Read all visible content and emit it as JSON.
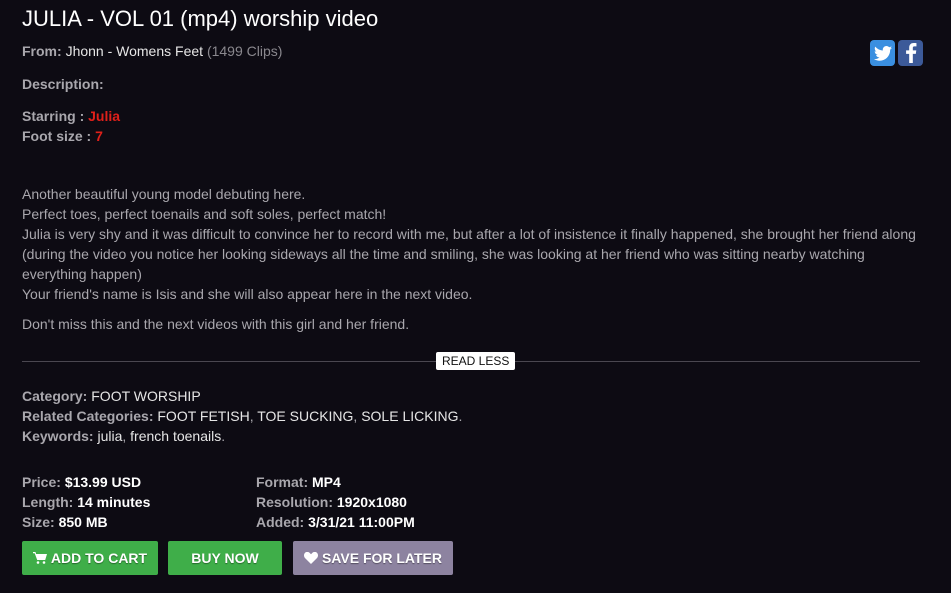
{
  "title": "JULIA - VOL 01 (mp4) worship video",
  "from": {
    "label": "From:",
    "studio": "Jhonn - Womens Feet",
    "clips": "(1499 Clips)"
  },
  "social": {
    "twitter_icon": "twitter-icon",
    "facebook_icon": "facebook-icon",
    "twitter_color": "#3a8fe0",
    "facebook_color": "#3c5a99"
  },
  "description_label": "Description:",
  "starring": {
    "label": "Starring :",
    "value": "Julia"
  },
  "foot_size": {
    "label": "Foot size :",
    "value": "7"
  },
  "body": [
    "Another beautiful young model debuting here.",
    "Perfect toes, perfect toenails and soft soles, perfect match!",
    "Julia is very shy and it was difficult to convince her to record with me, but after a lot of insistence it finally happened, she brought her friend along (during the video you notice her looking sideways all the time and smiling, she was looking at her friend who was sitting nearby watching everything happen)",
    "Your friend's name is Isis and she will also appear here in the next video.",
    "Don't miss this and the next videos with this girl and her friend."
  ],
  "read_less": "READ LESS",
  "category": {
    "label": "Category:",
    "value": "FOOT WORSHIP"
  },
  "related": {
    "label": "Related Categories:",
    "items": [
      "FOOT FETISH",
      "TOE SUCKING",
      "SOLE LICKING"
    ],
    "sep1": ", ",
    "sep2": ", ",
    "end": "."
  },
  "keywords": {
    "label": "Keywords:",
    "items": [
      "julia",
      "french toenails"
    ],
    "sep": ", ",
    "end": "."
  },
  "specs": {
    "price": {
      "label": "Price:",
      "value": "$13.99 USD"
    },
    "length": {
      "label": "Length:",
      "value": "14 minutes"
    },
    "size": {
      "label": "Size:",
      "value": "850 MB"
    },
    "format": {
      "label": "Format:",
      "value": "MP4"
    },
    "resolution": {
      "label": "Resolution:",
      "value": "1920x1080"
    },
    "added": {
      "label": "Added:",
      "value": "3/31/21 11:00PM"
    }
  },
  "actions": {
    "add_to_cart": "ADD TO CART",
    "buy_now": "BUY NOW",
    "save_for_later": "SAVE FOR LATER"
  },
  "colors": {
    "green": "#3fae49",
    "purple": "#8d83a0",
    "red": "#e0201a",
    "bg": "#0d0b13"
  }
}
